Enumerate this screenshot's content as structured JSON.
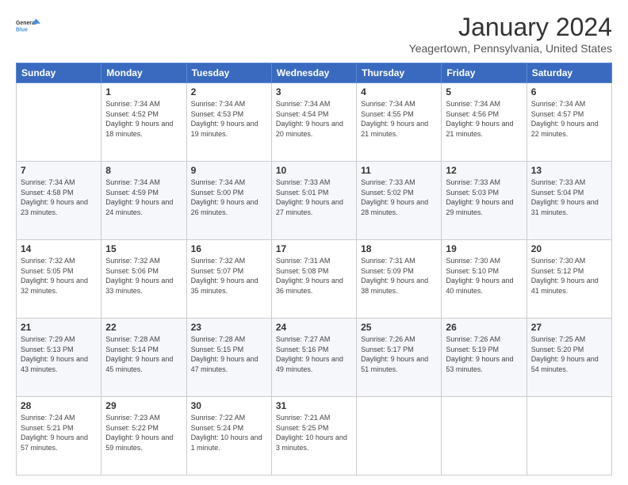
{
  "header": {
    "logo_line1": "General",
    "logo_line2": "Blue",
    "month_title": "January 2024",
    "location": "Yeagertown, Pennsylvania, United States"
  },
  "weekdays": [
    "Sunday",
    "Monday",
    "Tuesday",
    "Wednesday",
    "Thursday",
    "Friday",
    "Saturday"
  ],
  "weeks": [
    [
      {
        "day": "",
        "sunrise": "",
        "sunset": "",
        "daylight": ""
      },
      {
        "day": "1",
        "sunrise": "Sunrise: 7:34 AM",
        "sunset": "Sunset: 4:52 PM",
        "daylight": "Daylight: 9 hours and 18 minutes."
      },
      {
        "day": "2",
        "sunrise": "Sunrise: 7:34 AM",
        "sunset": "Sunset: 4:53 PM",
        "daylight": "Daylight: 9 hours and 19 minutes."
      },
      {
        "day": "3",
        "sunrise": "Sunrise: 7:34 AM",
        "sunset": "Sunset: 4:54 PM",
        "daylight": "Daylight: 9 hours and 20 minutes."
      },
      {
        "day": "4",
        "sunrise": "Sunrise: 7:34 AM",
        "sunset": "Sunset: 4:55 PM",
        "daylight": "Daylight: 9 hours and 21 minutes."
      },
      {
        "day": "5",
        "sunrise": "Sunrise: 7:34 AM",
        "sunset": "Sunset: 4:56 PM",
        "daylight": "Daylight: 9 hours and 21 minutes."
      },
      {
        "day": "6",
        "sunrise": "Sunrise: 7:34 AM",
        "sunset": "Sunset: 4:57 PM",
        "daylight": "Daylight: 9 hours and 22 minutes."
      }
    ],
    [
      {
        "day": "7",
        "sunrise": "Sunrise: 7:34 AM",
        "sunset": "Sunset: 4:58 PM",
        "daylight": "Daylight: 9 hours and 23 minutes."
      },
      {
        "day": "8",
        "sunrise": "Sunrise: 7:34 AM",
        "sunset": "Sunset: 4:59 PM",
        "daylight": "Daylight: 9 hours and 24 minutes."
      },
      {
        "day": "9",
        "sunrise": "Sunrise: 7:34 AM",
        "sunset": "Sunset: 5:00 PM",
        "daylight": "Daylight: 9 hours and 26 minutes."
      },
      {
        "day": "10",
        "sunrise": "Sunrise: 7:33 AM",
        "sunset": "Sunset: 5:01 PM",
        "daylight": "Daylight: 9 hours and 27 minutes."
      },
      {
        "day": "11",
        "sunrise": "Sunrise: 7:33 AM",
        "sunset": "Sunset: 5:02 PM",
        "daylight": "Daylight: 9 hours and 28 minutes."
      },
      {
        "day": "12",
        "sunrise": "Sunrise: 7:33 AM",
        "sunset": "Sunset: 5:03 PM",
        "daylight": "Daylight: 9 hours and 29 minutes."
      },
      {
        "day": "13",
        "sunrise": "Sunrise: 7:33 AM",
        "sunset": "Sunset: 5:04 PM",
        "daylight": "Daylight: 9 hours and 31 minutes."
      }
    ],
    [
      {
        "day": "14",
        "sunrise": "Sunrise: 7:32 AM",
        "sunset": "Sunset: 5:05 PM",
        "daylight": "Daylight: 9 hours and 32 minutes."
      },
      {
        "day": "15",
        "sunrise": "Sunrise: 7:32 AM",
        "sunset": "Sunset: 5:06 PM",
        "daylight": "Daylight: 9 hours and 33 minutes."
      },
      {
        "day": "16",
        "sunrise": "Sunrise: 7:32 AM",
        "sunset": "Sunset: 5:07 PM",
        "daylight": "Daylight: 9 hours and 35 minutes."
      },
      {
        "day": "17",
        "sunrise": "Sunrise: 7:31 AM",
        "sunset": "Sunset: 5:08 PM",
        "daylight": "Daylight: 9 hours and 36 minutes."
      },
      {
        "day": "18",
        "sunrise": "Sunrise: 7:31 AM",
        "sunset": "Sunset: 5:09 PM",
        "daylight": "Daylight: 9 hours and 38 minutes."
      },
      {
        "day": "19",
        "sunrise": "Sunrise: 7:30 AM",
        "sunset": "Sunset: 5:10 PM",
        "daylight": "Daylight: 9 hours and 40 minutes."
      },
      {
        "day": "20",
        "sunrise": "Sunrise: 7:30 AM",
        "sunset": "Sunset: 5:12 PM",
        "daylight": "Daylight: 9 hours and 41 minutes."
      }
    ],
    [
      {
        "day": "21",
        "sunrise": "Sunrise: 7:29 AM",
        "sunset": "Sunset: 5:13 PM",
        "daylight": "Daylight: 9 hours and 43 minutes."
      },
      {
        "day": "22",
        "sunrise": "Sunrise: 7:28 AM",
        "sunset": "Sunset: 5:14 PM",
        "daylight": "Daylight: 9 hours and 45 minutes."
      },
      {
        "day": "23",
        "sunrise": "Sunrise: 7:28 AM",
        "sunset": "Sunset: 5:15 PM",
        "daylight": "Daylight: 9 hours and 47 minutes."
      },
      {
        "day": "24",
        "sunrise": "Sunrise: 7:27 AM",
        "sunset": "Sunset: 5:16 PM",
        "daylight": "Daylight: 9 hours and 49 minutes."
      },
      {
        "day": "25",
        "sunrise": "Sunrise: 7:26 AM",
        "sunset": "Sunset: 5:17 PM",
        "daylight": "Daylight: 9 hours and 51 minutes."
      },
      {
        "day": "26",
        "sunrise": "Sunrise: 7:26 AM",
        "sunset": "Sunset: 5:19 PM",
        "daylight": "Daylight: 9 hours and 53 minutes."
      },
      {
        "day": "27",
        "sunrise": "Sunrise: 7:25 AM",
        "sunset": "Sunset: 5:20 PM",
        "daylight": "Daylight: 9 hours and 54 minutes."
      }
    ],
    [
      {
        "day": "28",
        "sunrise": "Sunrise: 7:24 AM",
        "sunset": "Sunset: 5:21 PM",
        "daylight": "Daylight: 9 hours and 57 minutes."
      },
      {
        "day": "29",
        "sunrise": "Sunrise: 7:23 AM",
        "sunset": "Sunset: 5:22 PM",
        "daylight": "Daylight: 9 hours and 59 minutes."
      },
      {
        "day": "30",
        "sunrise": "Sunrise: 7:22 AM",
        "sunset": "Sunset: 5:24 PM",
        "daylight": "Daylight: 10 hours and 1 minute."
      },
      {
        "day": "31",
        "sunrise": "Sunrise: 7:21 AM",
        "sunset": "Sunset: 5:25 PM",
        "daylight": "Daylight: 10 hours and 3 minutes."
      },
      {
        "day": "",
        "sunrise": "",
        "sunset": "",
        "daylight": ""
      },
      {
        "day": "",
        "sunrise": "",
        "sunset": "",
        "daylight": ""
      },
      {
        "day": "",
        "sunrise": "",
        "sunset": "",
        "daylight": ""
      }
    ]
  ]
}
